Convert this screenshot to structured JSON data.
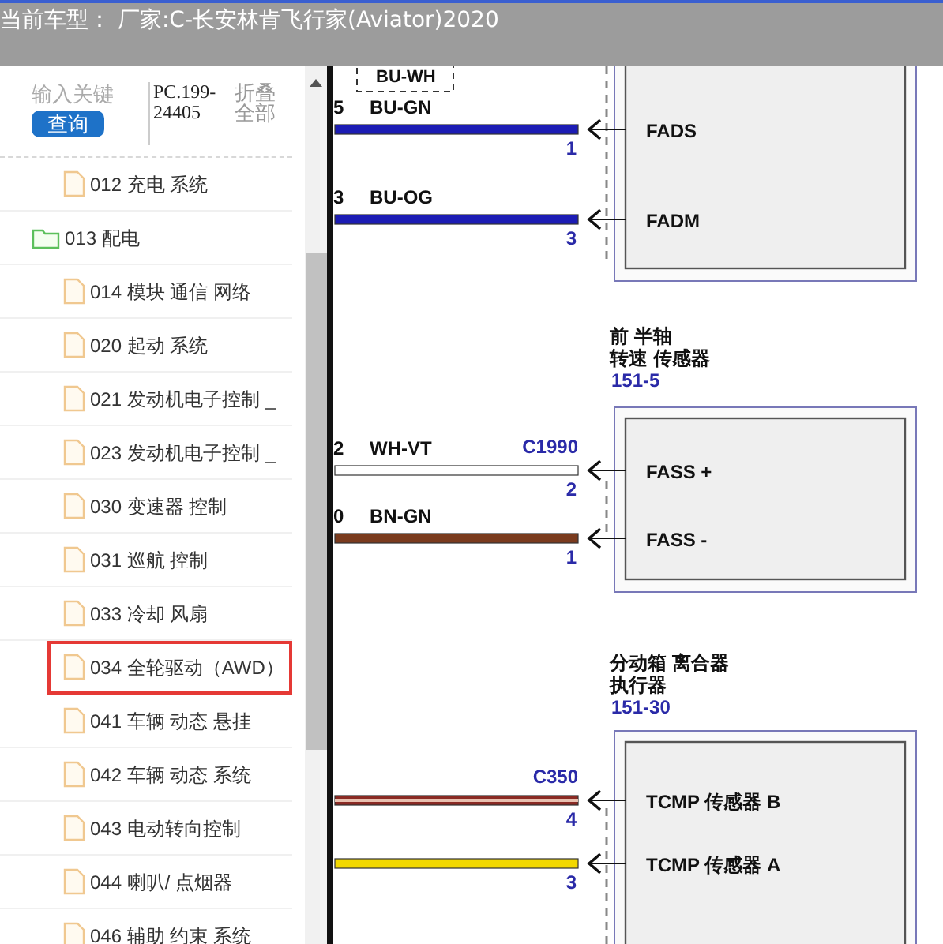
{
  "header": {
    "title": "当前车型：  厂家:C-长安林肯飞行家(Aviator)2020"
  },
  "search": {
    "placeholder": "输入关键",
    "button": "查询",
    "code": "PC.199-24405",
    "collapse": "折叠全部"
  },
  "tree": [
    {
      "kind": "file",
      "label": "012 充电 系统",
      "selected": false
    },
    {
      "kind": "folder",
      "label": "013 配电",
      "selected": false
    },
    {
      "kind": "file",
      "label": "014 模块 通信 网络",
      "selected": false
    },
    {
      "kind": "file",
      "label": "020 起动 系统",
      "selected": false
    },
    {
      "kind": "file",
      "label": "021 发动机电子控制 _",
      "selected": false
    },
    {
      "kind": "file",
      "label": "023 发动机电子控制 _",
      "selected": false
    },
    {
      "kind": "file",
      "label": "030 变速器 控制",
      "selected": false
    },
    {
      "kind": "file",
      "label": "031 巡航 控制",
      "selected": false
    },
    {
      "kind": "file",
      "label": "033 冷却 风扇",
      "selected": false
    },
    {
      "kind": "file",
      "label": "034 全轮驱动（AWD）",
      "selected": true
    },
    {
      "kind": "file",
      "label": "041 车辆 动态 悬挂",
      "selected": false
    },
    {
      "kind": "file",
      "label": "042 车辆 动态 系统",
      "selected": false
    },
    {
      "kind": "file",
      "label": "043 电动转向控制",
      "selected": false
    },
    {
      "kind": "file",
      "label": "044 喇叭/ 点烟器",
      "selected": false
    },
    {
      "kind": "file",
      "label": "046 辅助 约束 系统",
      "selected": false
    }
  ],
  "diagram": {
    "top_wire_code": "BU-WH",
    "components": [
      {
        "pins": [
          "FADS",
          "FADM"
        ],
        "wires": [
          {
            "kind": "solid",
            "cut_pin": "5",
            "code": "BU-GN",
            "pin": "1",
            "color": "#1c1cb4"
          },
          {
            "kind": "solid",
            "cut_pin": "3",
            "code": "BU-OG",
            "pin": "3",
            "color": "#1c1cb4"
          }
        ]
      },
      {
        "title": [
          "前 半轴",
          "转速 传感器"
        ],
        "ref": "151-5",
        "pins": [
          "FASS +",
          "FASS -"
        ],
        "wires": [
          {
            "kind": "solid",
            "cut_pin": "2",
            "code": "WH-VT",
            "connector": "C1990",
            "pin": "2",
            "color": "#ffffff"
          },
          {
            "kind": "solid",
            "cut_pin": "0",
            "code": "BN-GN",
            "pin": "1",
            "color": "#7a3b1e"
          }
        ]
      },
      {
        "title": [
          "分动箱 离合器",
          "执行器"
        ],
        "ref": "151-30",
        "pins": [
          "TCMP 传感器 B",
          "TCMP 传感器 A"
        ],
        "wires": [
          {
            "kind": "striped",
            "connector": "C350",
            "pin": "4",
            "color": "#8a2a24"
          },
          {
            "kind": "solid",
            "pin": "3",
            "color": "#f2d800"
          }
        ]
      }
    ]
  }
}
